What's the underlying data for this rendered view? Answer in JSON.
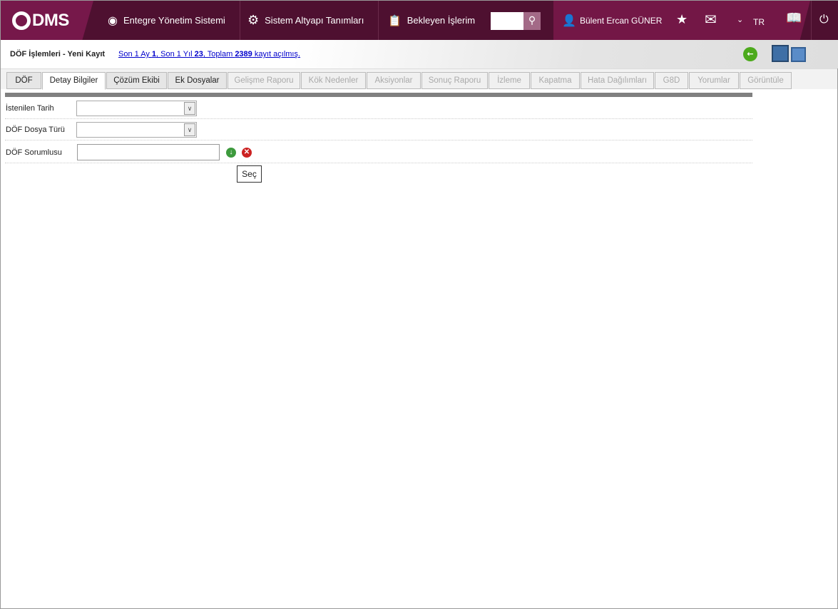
{
  "header": {
    "logo": "QDMS",
    "nav": [
      "Entegre Yönetim Sistemi",
      "Sistem Altyapı Tanımları",
      "Bekleyen İşlerim"
    ],
    "user": "Bülent Ercan GÜNER",
    "language": "TR"
  },
  "page": {
    "title": "DÖF İşlemleri - Yeni Kayıt",
    "stats": {
      "p1": "Son 1 Ay ",
      "v1": "1",
      "p2": ", Son 1 Yıl ",
      "v2": "23",
      "p3": ", Toplam ",
      "v3": "2389",
      "p4": " kayıt açılmış."
    }
  },
  "tabs": [
    {
      "label": "DÖF"
    },
    {
      "label": "Detay Bilgiler"
    },
    {
      "label": "Çözüm Ekibi"
    },
    {
      "label": "Ek Dosyalar"
    },
    {
      "label": "Gelişme Raporu"
    },
    {
      "label": "Kök Nedenler"
    },
    {
      "label": "Aksiyonlar"
    },
    {
      "label": "Sonuç Raporu"
    },
    {
      "label": "İzleme"
    },
    {
      "label": "Kapatma"
    },
    {
      "label": "Hata Dağılımları"
    },
    {
      "label": "G8D"
    },
    {
      "label": "Yorumlar"
    },
    {
      "label": "Görüntüle"
    }
  ],
  "form": {
    "f1": {
      "label": "İstenilen Tarih",
      "value": ""
    },
    "f2": {
      "label": "DÖF Dosya Türü",
      "value": ""
    },
    "f3": {
      "label": "DÖF Sorumlusu",
      "value": ""
    }
  },
  "tooltip": "Seç"
}
